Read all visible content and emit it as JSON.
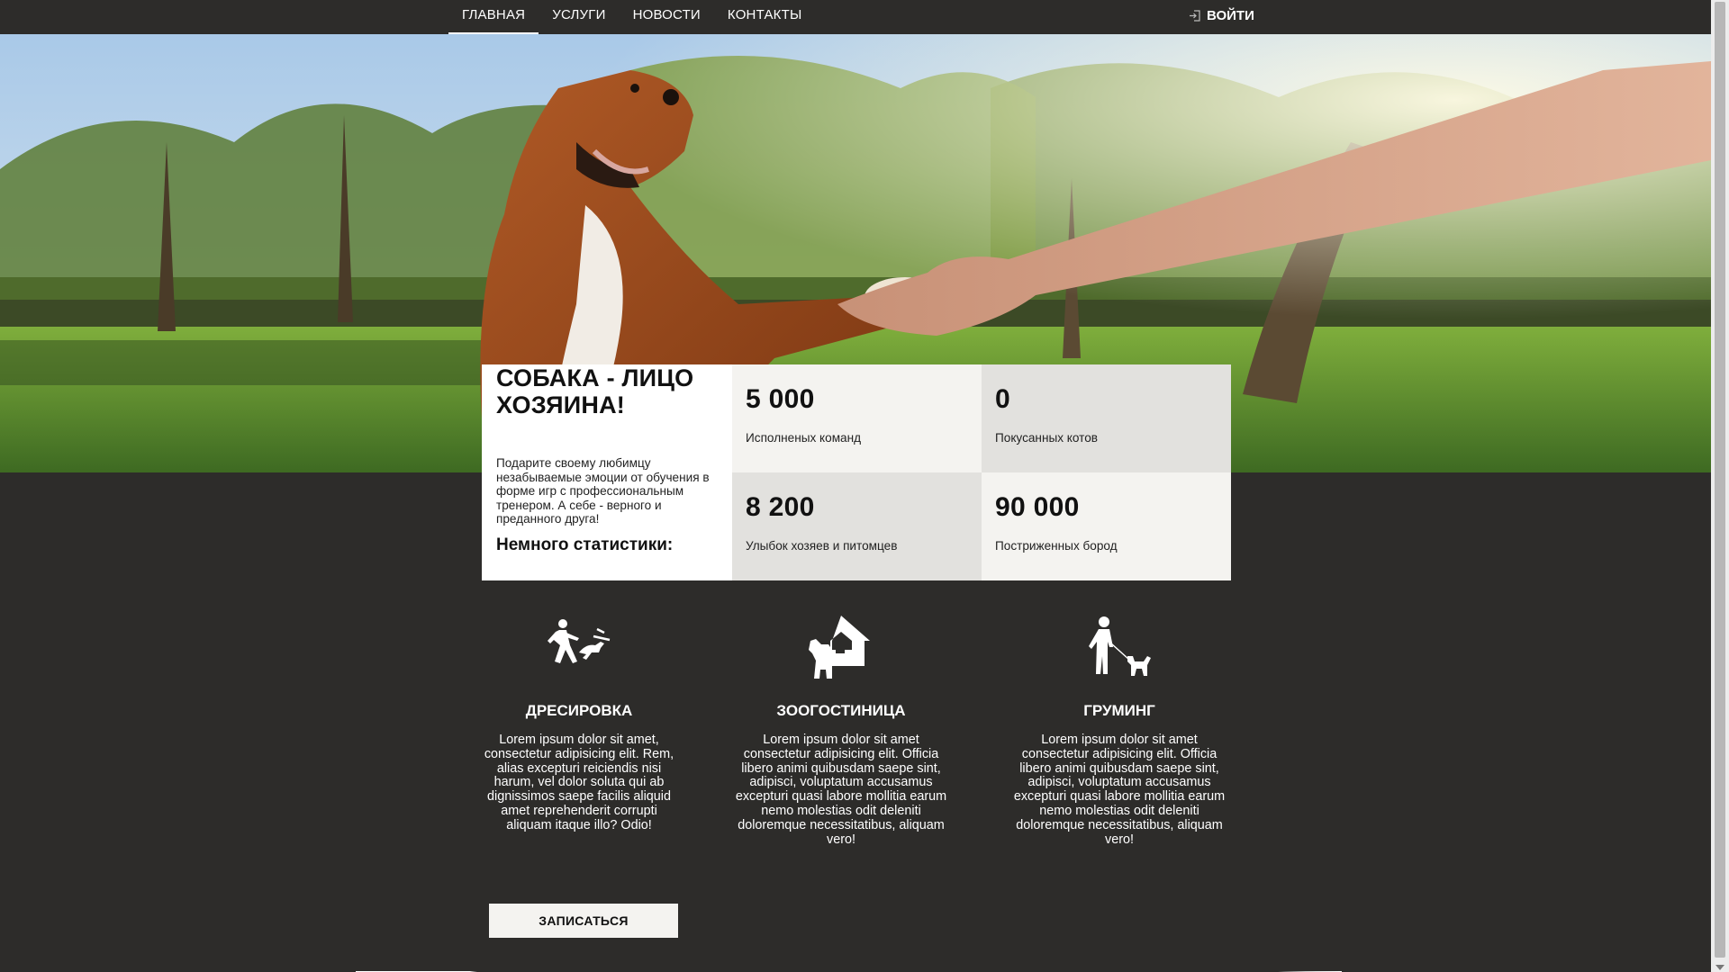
{
  "nav": {
    "items": [
      {
        "label": "ГЛАВНАЯ",
        "active": true
      },
      {
        "label": "УСЛУГИ"
      },
      {
        "label": "НОВОСТИ"
      },
      {
        "label": "КОНТАКТЫ"
      }
    ],
    "login_label": "ВОЙТИ",
    "login_icon": "login-icon"
  },
  "hero": {
    "image": "dog-giving-paw-to-hand-photo"
  },
  "intro": {
    "title": "СОБАКА - ЛИЦО ХОЗЯИНА!",
    "text": "Подарите своему любимцу незабываемые эмоции от обучения в форме игр с профессиональным тренером. А себе - верного и преданного друга!",
    "stats_heading": "Немного статистики:"
  },
  "stats": [
    {
      "value": "5 000",
      "label": "Исполненых команд"
    },
    {
      "value": "0",
      "label": "Покусанных котов"
    },
    {
      "value": "8 200",
      "label": "Улыбок хозяев и питомцев"
    },
    {
      "value": "90 000",
      "label": "Постриженных бород"
    }
  ],
  "services": [
    {
      "icon": "trainer-with-dog-icon",
      "title": "ДРЕСИРОВКА",
      "text": "Lorem ipsum dolor sit amet, consectetur adipisicing elit. Rem, alias excepturi reiciendis nisi harum, vel dolor soluta qui ab dignissimos saepe facilis aliquid amet reprehenderit corrupti aliquam itaque illo? Odio!"
    },
    {
      "icon": "dog-house-icon",
      "title": "ЗООГОСТИНИЦА",
      "text": "Lorem ipsum dolor sit amet consectetur adipisicing elit. Officia libero animi quibusdam saepe sint, adipisci, voluptatum accusamus excepturi quasi labore mollitia earum nemo molestias odit deleniti doloremque necessitatibus, aliquam vero!"
    },
    {
      "icon": "dog-walker-icon",
      "title": "ГРУМИНГ",
      "text": "Lorem ipsum dolor sit amet consectetur adipisicing elit. Officia libero animi quibusdam saepe sint, adipisci, voluptatum accusamus excepturi quasi labore mollitia earum nemo molestias odit deleniti doloremque necessitatibus, aliquam vero!"
    }
  ],
  "cta_label": "ЗАПИСАТЬСЯ",
  "colors": {
    "page_bg": "#2d2c2a",
    "panel_light": "#f4f3f0",
    "panel_gray": "#e2e1de",
    "text_dark": "#111111"
  }
}
